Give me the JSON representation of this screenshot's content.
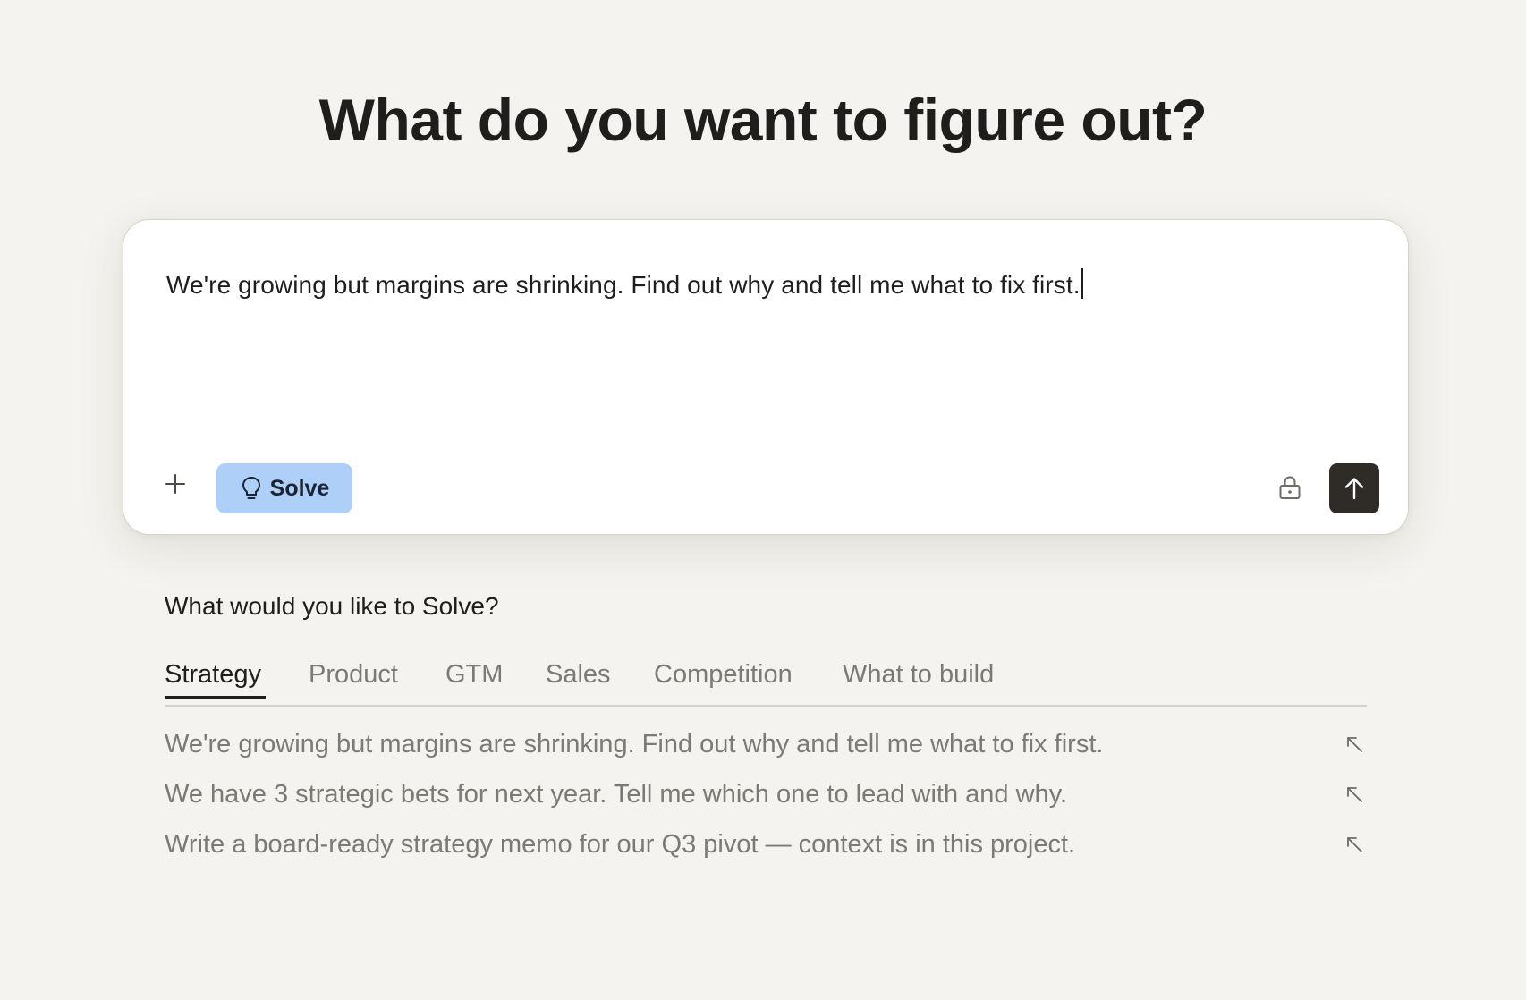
{
  "title": "What do you want to figure out?",
  "composer": {
    "input_value": "We're growing but margins are shrinking. Find out why and tell me what to fix first.",
    "plus_icon": "plus-icon",
    "mode_button": {
      "label": "Solve",
      "icon": "lightbulb-icon",
      "color": "#aecff8"
    },
    "lock_icon": "lock-icon",
    "send_icon": "arrow-up-icon",
    "send_color": "#2f2b27"
  },
  "suggestions": {
    "heading": "What would you like to Solve?",
    "tabs": [
      {
        "label": "Strategy",
        "active": true
      },
      {
        "label": "Product",
        "active": false
      },
      {
        "label": "GTM",
        "active": false
      },
      {
        "label": "Sales",
        "active": false
      },
      {
        "label": "Competition",
        "active": false
      },
      {
        "label": "What to build",
        "active": false
      }
    ],
    "items": [
      {
        "text": "We're growing but margins are shrinking. Find out why and tell me what to fix first.",
        "icon": "arrow-up-left-icon"
      },
      {
        "text": "We have 3 strategic bets for next year. Tell me which one to lead with and why.",
        "icon": "arrow-up-left-icon"
      },
      {
        "text": "Write a board-ready strategy memo for our Q3 pivot — context is in this project.",
        "icon": "arrow-up-left-icon"
      }
    ]
  },
  "colors": {
    "background": "#f4f3ef",
    "text_primary": "#1f1e1c",
    "text_muted": "#7c7a74"
  }
}
